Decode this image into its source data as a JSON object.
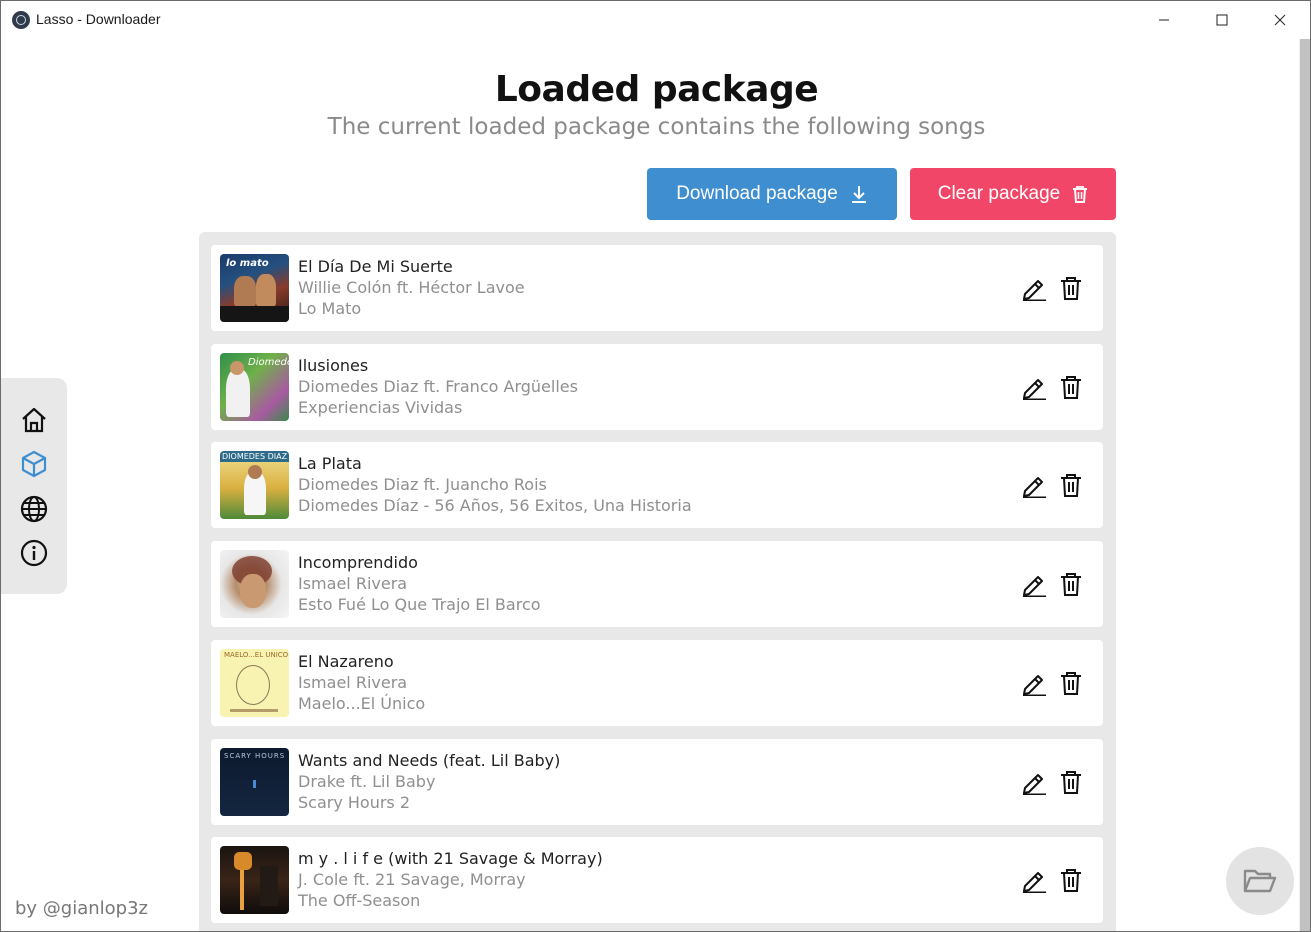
{
  "window": {
    "title": "Lasso - Downloader"
  },
  "header": {
    "title": "Loaded package",
    "subtitle": "The current loaded package contains the following songs"
  },
  "actions": {
    "download_label": "Download package",
    "clear_label": "Clear package"
  },
  "songs": [
    {
      "title": "El Día De Mi Suerte",
      "artist": "Willie Colón ft. Héctor Lavoe",
      "album": "Lo Mato"
    },
    {
      "title": "Ilusiones",
      "artist": "Diomedes Diaz ft. Franco Argüelles",
      "album": "Experiencias Vividas"
    },
    {
      "title": "La Plata",
      "artist": "Diomedes Diaz ft. Juancho Rois",
      "album": "Diomedes Díaz - 56 Años, 56 Exitos, Una Historia"
    },
    {
      "title": "Incomprendido",
      "artist": "Ismael Rivera",
      "album": "Esto Fué Lo Que Trajo El Barco"
    },
    {
      "title": "El Nazareno",
      "artist": "Ismael Rivera",
      "album": "Maelo...El Único"
    },
    {
      "title": "Wants and Needs (feat. Lil Baby)",
      "artist": "Drake ft. Lil Baby",
      "album": "Scary Hours 2"
    },
    {
      "title": "m y . l i f e (with 21 Savage & Morray)",
      "artist": "J. Cole ft. 21 Savage, Morray",
      "album": "The Off-Season"
    }
  ],
  "sidebar": {
    "items": [
      {
        "name": "home",
        "icon": "home-icon",
        "active": false
      },
      {
        "name": "package",
        "icon": "package-icon",
        "active": true
      },
      {
        "name": "world",
        "icon": "globe-icon",
        "active": false
      },
      {
        "name": "about",
        "icon": "info-icon",
        "active": false
      }
    ]
  },
  "footer": {
    "credit": "by @gianlop3z"
  },
  "colors": {
    "primary": "#3e8ed0",
    "danger": "#f14668",
    "active_icon": "#3e8ed0",
    "panel": "#e8e8e8"
  }
}
